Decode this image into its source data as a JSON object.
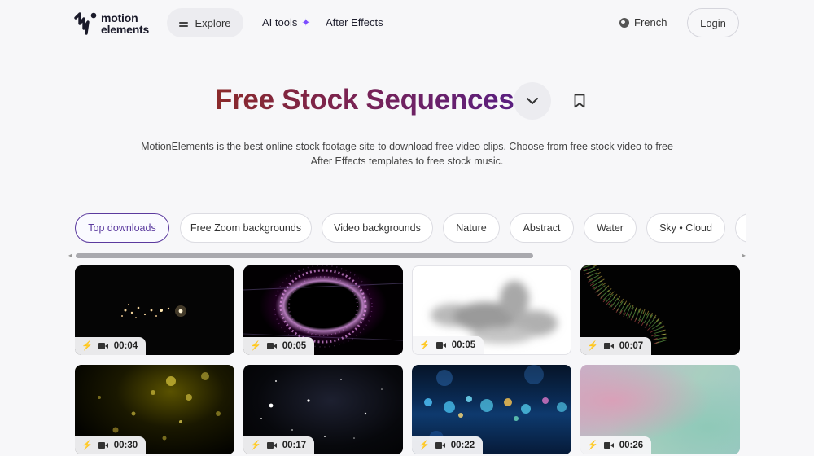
{
  "header": {
    "logo_text_line1": "motion",
    "logo_text_line2": "elements",
    "explore_label": "Explore",
    "ai_tools_label": "AI tools",
    "after_effects_label": "After Effects",
    "language_label": "French",
    "login_label": "Login"
  },
  "hero": {
    "title": "Free Stock Sequences",
    "description": "MotionElements is the best online stock footage site to download free video clips. Choose from free stock video to free After Effects templates to free stock music."
  },
  "chips": [
    {
      "label": "Top downloads",
      "active": true
    },
    {
      "label": "Free Zoom backgrounds",
      "active": false
    },
    {
      "label": "Video backgrounds",
      "active": false
    },
    {
      "label": "Nature",
      "active": false
    },
    {
      "label": "Abstract",
      "active": false
    },
    {
      "label": "Water",
      "active": false
    },
    {
      "label": "Sky • Cloud",
      "active": false
    },
    {
      "label": "",
      "active": false
    }
  ],
  "scrollbar": {
    "position_fraction": 0.0,
    "visible_fraction": 0.68
  },
  "clips": [
    {
      "duration": "00:04",
      "thumbnail": "golden-sparkles-on-black"
    },
    {
      "duration": "00:05",
      "thumbnail": "pink-particle-ring"
    },
    {
      "duration": "00:05",
      "thumbnail": "grey-smoke-on-white"
    },
    {
      "duration": "00:07",
      "thumbnail": "colorful-particle-wave"
    },
    {
      "duration": "00:30",
      "thumbnail": "gold-glitter-bokeh"
    },
    {
      "duration": "00:17",
      "thumbnail": "starfield"
    },
    {
      "duration": "00:22",
      "thumbnail": "blue-bokeh-lights"
    },
    {
      "duration": "00:26",
      "thumbnail": "pastel-gradient"
    }
  ],
  "icons": {
    "explore": "menu-icon",
    "ai_tools": "sparkle-icon",
    "language": "globe-icon",
    "dropdown": "chevron-down-icon",
    "bookmark": "bookmark-icon",
    "clip_badge": [
      "lightning-icon",
      "video-camera-icon"
    ]
  },
  "colors": {
    "accent": "#5b3a9e",
    "title_gradient_start": "#8b2a2a",
    "title_gradient_end": "#5a1f80",
    "badge_bolt": "#3d8bd9"
  }
}
